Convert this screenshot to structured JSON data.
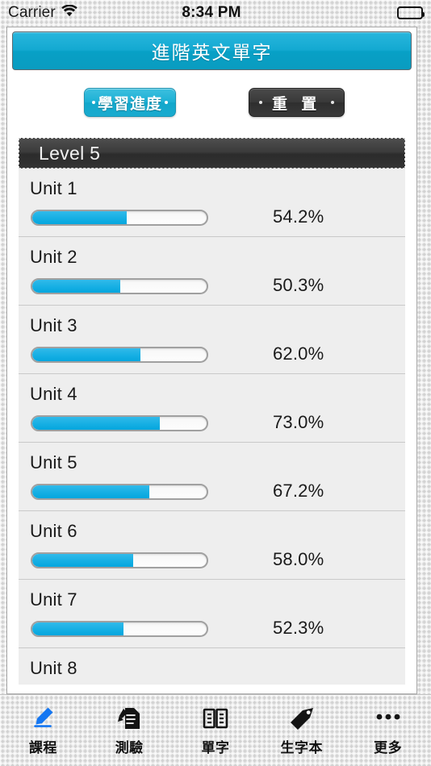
{
  "status_bar": {
    "carrier": "Carrier",
    "wifi_icon": "wifi-icon",
    "time": "8:34 PM",
    "battery_icon": "battery-full-icon"
  },
  "header": {
    "title": "進階英文單字",
    "accent_color": "#12a7cb"
  },
  "actions": {
    "progress_button": {
      "label": "學習進度",
      "style": "blue",
      "left_dot": "·",
      "right_dot": "·"
    },
    "reset_button": {
      "label": "重 置",
      "style": "dark",
      "left_dot": "·",
      "right_dot": "·"
    }
  },
  "list": {
    "section_header": "Level 5",
    "units": [
      {
        "name": "Unit 1",
        "percent_label": "54.2%",
        "percent": 54.2
      },
      {
        "name": "Unit 2",
        "percent_label": "50.3%",
        "percent": 50.3
      },
      {
        "name": "Unit 3",
        "percent_label": "62.0%",
        "percent": 62.0
      },
      {
        "name": "Unit 4",
        "percent_label": "73.0%",
        "percent": 73.0
      },
      {
        "name": "Unit 5",
        "percent_label": "67.2%",
        "percent": 67.2
      },
      {
        "name": "Unit 6",
        "percent_label": "58.0%",
        "percent": 58.0
      },
      {
        "name": "Unit 7",
        "percent_label": "52.3%",
        "percent": 52.3
      },
      {
        "name": "Unit 8",
        "percent_label": "",
        "percent": null
      }
    ]
  },
  "tab_bar": {
    "active_index": 0,
    "active_color": "#1577f2",
    "items": [
      {
        "label": "課程",
        "icon": "pencil-icon"
      },
      {
        "label": "測驗",
        "icon": "document-pen-icon"
      },
      {
        "label": "單字",
        "icon": "open-book-icon"
      },
      {
        "label": "生字本",
        "icon": "tag-icon"
      },
      {
        "label": "更多",
        "icon": "ellipsis-icon"
      }
    ]
  }
}
